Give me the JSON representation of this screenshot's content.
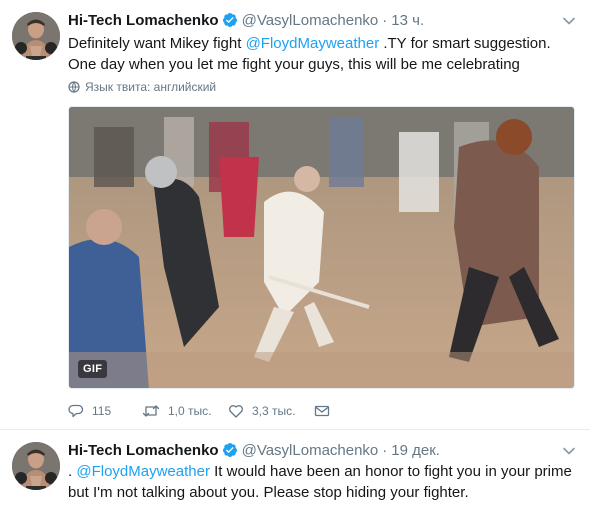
{
  "tweets": [
    {
      "author": {
        "fullname": "Hi-Tech Lomachenko",
        "username": "@VasylLomachenko",
        "verified": true,
        "avatar_icon": "boxer-avatar"
      },
      "time": "13 ч.",
      "text_before": "Definitely want Mikey fight ",
      "mention": "@FloydMayweather",
      "text_after": " .TY for smart suggestion. One day when you let me fight your guys, this will be me celebrating",
      "translate_label": "Язык твита: английский",
      "media": {
        "badge": "GIF",
        "description_icon": "dancing-crowd-gif"
      },
      "actions": {
        "reply_count": "115",
        "retweet_count": "1,0 тыс.",
        "like_count": "3,3 тыс.",
        "dm_icon": "envelope-icon"
      }
    },
    {
      "author": {
        "fullname": "Hi-Tech Lomachenko",
        "username": "@VasylLomachenko",
        "verified": true,
        "avatar_icon": "boxer-avatar"
      },
      "time": "19 дек.",
      "text_before": ". ",
      "mention": "@FloydMayweather",
      "text_after": " It would have been an honor to fight you in your prime but I'm not talking about you. Please stop hiding your fighter."
    }
  ],
  "colors": {
    "accent": "#1da1f2",
    "secondary_text": "#657786",
    "primary_text": "#14171a",
    "divider": "#e6ecf0"
  }
}
